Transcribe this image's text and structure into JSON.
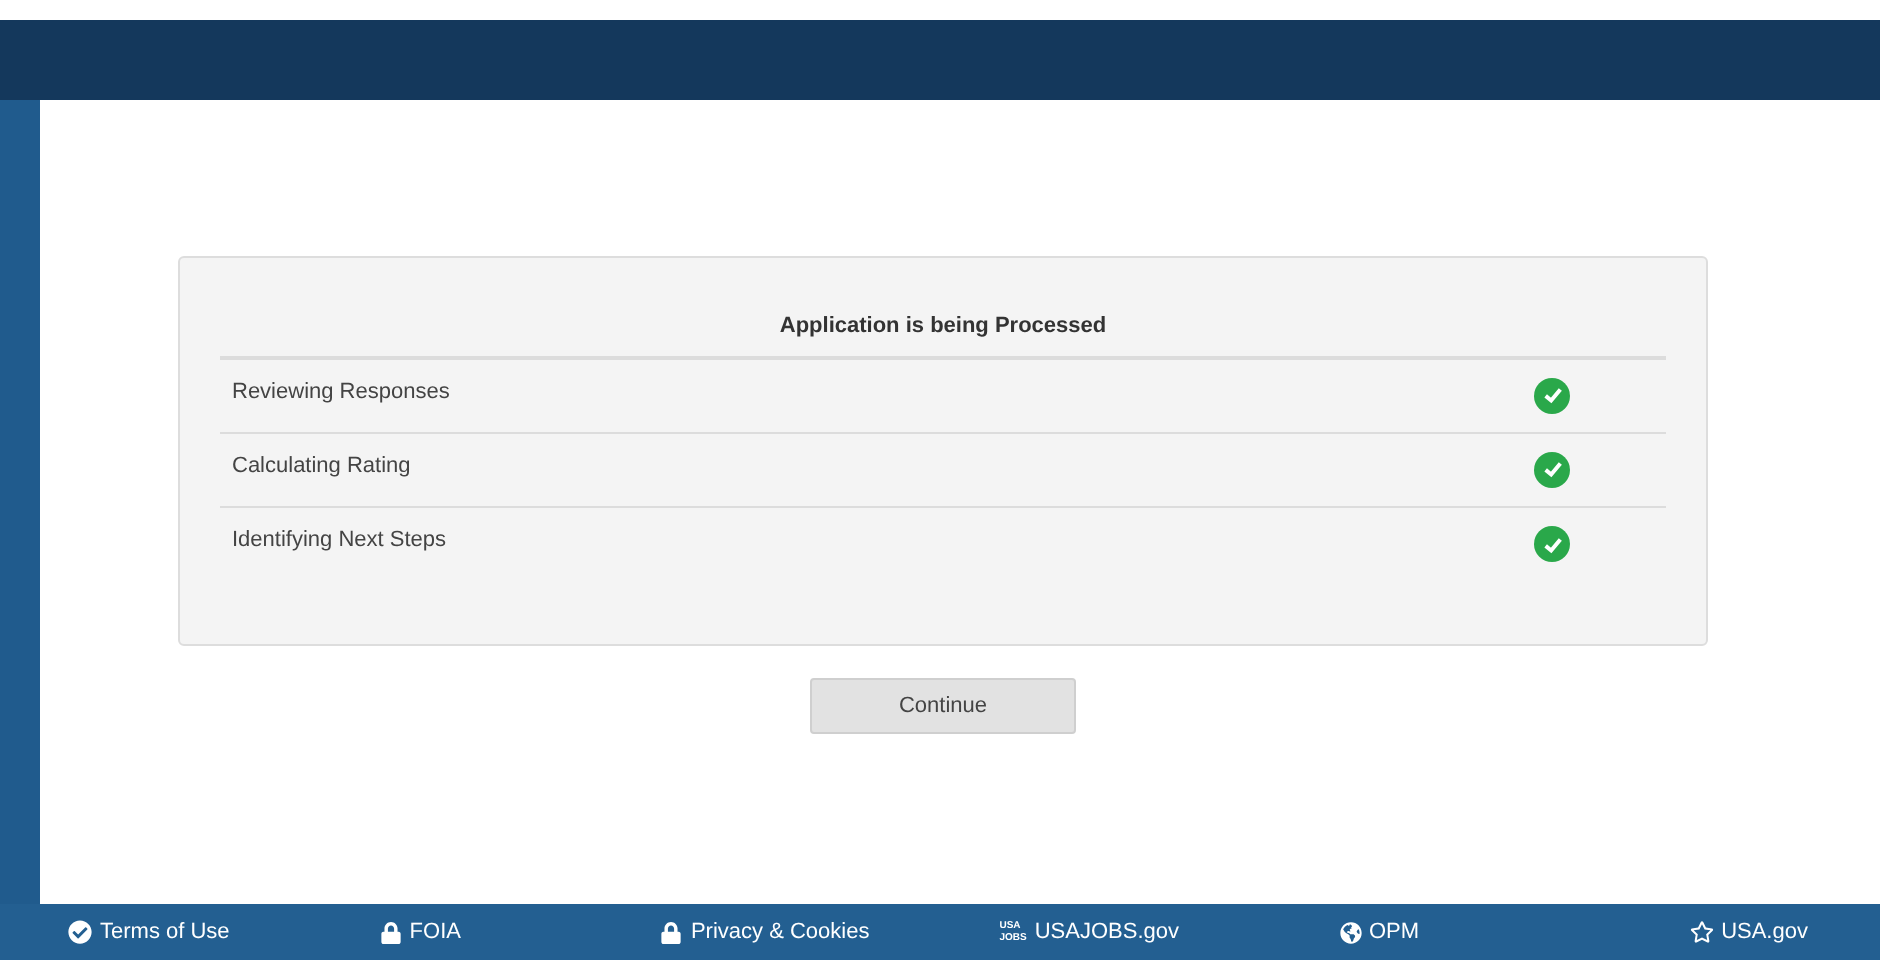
{
  "card": {
    "title": "Application is being Processed",
    "steps": [
      {
        "label": "Reviewing Responses",
        "done": true
      },
      {
        "label": "Calculating Rating",
        "done": true
      },
      {
        "label": "Identifying Next Steps",
        "done": true
      }
    ]
  },
  "continue_button": "Continue",
  "footer": {
    "links": [
      {
        "label": "Terms of Use",
        "kind": "check"
      },
      {
        "label": "FOIA",
        "kind": "lock"
      },
      {
        "label": "Privacy & Cookies",
        "kind": "lock"
      },
      {
        "label": "USAJOBS.gov",
        "kind": "logo",
        "logo_text": [
          "USA",
          "JOBS"
        ]
      },
      {
        "label": "OPM",
        "kind": "globe"
      },
      {
        "label": "USA.gov",
        "kind": "star"
      }
    ]
  }
}
